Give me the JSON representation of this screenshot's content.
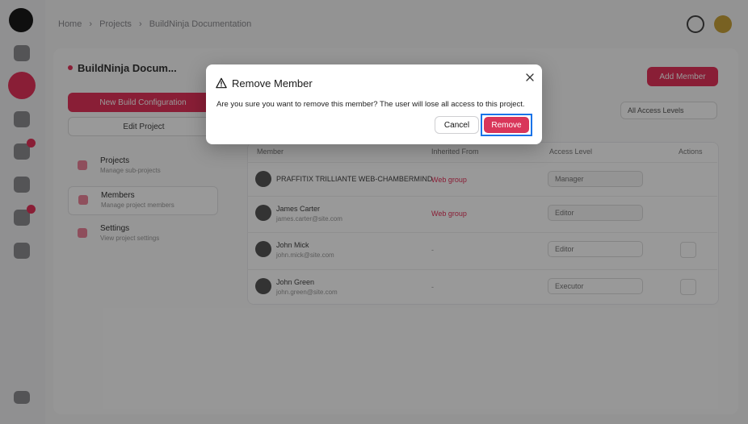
{
  "breadcrumb": {
    "home": "Home",
    "projects": "Projects",
    "current": "BuildNinja Documentation"
  },
  "sidebar_project": {
    "title": "BuildNinja Docum...",
    "new_build_config": "New Build Configuration",
    "edit_project": "Edit Project",
    "nav": [
      {
        "label": "Projects",
        "sub": "Manage sub-projects"
      },
      {
        "label": "Members",
        "sub": "Manage project members"
      },
      {
        "label": "Settings",
        "sub": "View project settings"
      }
    ]
  },
  "members": {
    "add_button": "Add Member",
    "filter": "All Access Levels",
    "columns": [
      "Member",
      "Inherited From",
      "Access Level",
      "Actions"
    ],
    "rows": [
      {
        "name": "PRAFFITIX TRILLIANTE WEB-CHAMBERMIND",
        "email": "",
        "inherited": "Web group",
        "access": "Manager"
      },
      {
        "name": "James Carter",
        "email": "james.carter@site.com",
        "inherited": "Web group",
        "access": "Editor"
      },
      {
        "name": "John Mick",
        "email": "john.mick@site.com",
        "inherited": "-",
        "access": "Editor"
      },
      {
        "name": "John Green",
        "email": "john.green@site.com",
        "inherited": "-",
        "access": "Executor"
      }
    ]
  },
  "dialog": {
    "title": "Remove Member",
    "message": "Are you sure you want to remove this member? The user will lose all access to this project.",
    "cancel_label": "Cancel",
    "remove_label": "Remove"
  },
  "colors": {
    "accent": "#e5335a",
    "focus_ring": "#1a73e8",
    "overlay": "rgba(0,0,0,0.40)"
  },
  "icons": {
    "warning": "warning-icon",
    "close": "close-icon"
  }
}
